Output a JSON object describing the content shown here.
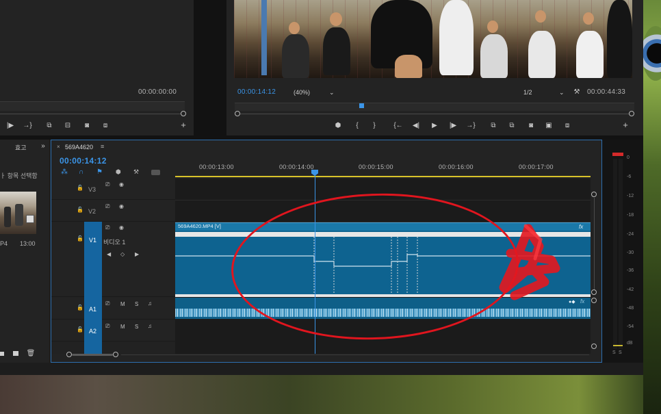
{
  "source_monitor": {
    "timecode": "00:00:00:00"
  },
  "program_monitor": {
    "current_timecode": "00:00:14:12",
    "zoom": "(40%)",
    "resolution": "1/2",
    "duration": "00:00:44:33"
  },
  "project_panel": {
    "tab_effects": "효고",
    "hint_text": "ㅏ 항목 선택함",
    "thumb_meta_left": "P4",
    "thumb_meta_right": "13:00"
  },
  "timeline": {
    "sequence_name": "569A4620",
    "current_timecode": "00:00:14:12",
    "ruler_ticks": [
      "00:00:13:00",
      "00:00:14:00",
      "00:00:15:00",
      "00:00:16:00",
      "00:00:17:00"
    ],
    "tracks": {
      "v3": "V3",
      "v2": "V2",
      "v1": "V1",
      "v1_name": "비디오 1",
      "a1": "A1",
      "a2": "A2"
    },
    "clip_label": "569A4620.MP4 [V]",
    "fx_badge": "fx",
    "track_m": "M",
    "track_s": "S"
  },
  "audio_meter": {
    "scale": [
      "0",
      "-6",
      "-12",
      "-18",
      "-24",
      "-30",
      "-36",
      "-42",
      "-48",
      "-54",
      "dB"
    ],
    "solo_left": "S",
    "solo_right": "S"
  },
  "icons": {
    "play": "▶",
    "step_back": "◀|",
    "step_forward": "|▶",
    "marker": "⬢",
    "in_point": "{",
    "out_point": "}",
    "camera": "📷",
    "wrench": "🔧",
    "add": "+",
    "menu": "≡",
    "close": "×",
    "lock": "🔒",
    "eye": "👁",
    "mic": "🎤",
    "chevrons": "»"
  },
  "annotation": {
    "ellipse_color": "#e0151e"
  }
}
